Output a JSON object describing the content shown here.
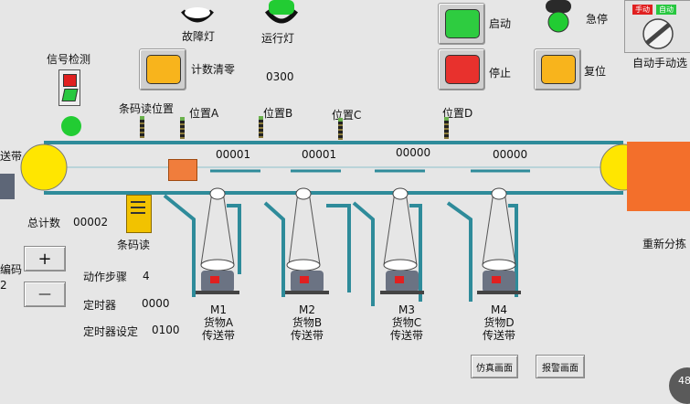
{
  "lamps": {
    "fault": {
      "label": "故障灯",
      "color": "#ffffff"
    },
    "run": {
      "label": "运行灯",
      "color": "#22cc33"
    }
  },
  "signal": {
    "label": "信号检测"
  },
  "counter_reset": {
    "label": "计数清零",
    "value": "0300"
  },
  "controls": {
    "start": {
      "label": "启动"
    },
    "stop": {
      "label": "停止"
    },
    "reset": {
      "label": "复位"
    },
    "estop": {
      "label": "急停"
    },
    "auto_manual": {
      "label": "自动手动选",
      "manual_tag": "手动",
      "auto_tag": "自动"
    }
  },
  "conveyor": {
    "left_label": "送带",
    "barcode_pos_label": "条码读位置",
    "positions": [
      {
        "label": "位置A"
      },
      {
        "label": "位置B"
      },
      {
        "label": "位置C"
      },
      {
        "label": "位置D"
      }
    ],
    "counts": [
      "00001",
      "00001",
      "00000",
      "00000"
    ],
    "right_label": "重新分拣"
  },
  "barcode_reader": {
    "label": "条码读"
  },
  "stats": {
    "total_label": "总计数",
    "total_value": "00002",
    "code_label": "编码",
    "code_value": "2",
    "plus_label": "+",
    "minus_label": "—",
    "step_label": "动作步骤",
    "step_value": "4",
    "timer_label": "定时器",
    "timer_value": "0000",
    "timer_set_label": "定时器设定",
    "timer_set_value": "0100"
  },
  "motors": [
    {
      "id": "M1",
      "line1": "货物A",
      "line2": "传送带"
    },
    {
      "id": "M2",
      "line1": "货物B",
      "line2": "传送带"
    },
    {
      "id": "M3",
      "line1": "货物C",
      "line2": "传送带"
    },
    {
      "id": "M4",
      "line1": "货物D",
      "line2": "传送带"
    }
  ],
  "nav": {
    "sim_label": "仿真画面",
    "alarm_label": "报警画面",
    "corner_badge": "48"
  },
  "colors": {
    "belt": "#2e8b9a",
    "roller": "#ffe600",
    "package": "#f07d3c",
    "resort_bin": "#f36f2b",
    "barcode_device": "#f2c200"
  }
}
